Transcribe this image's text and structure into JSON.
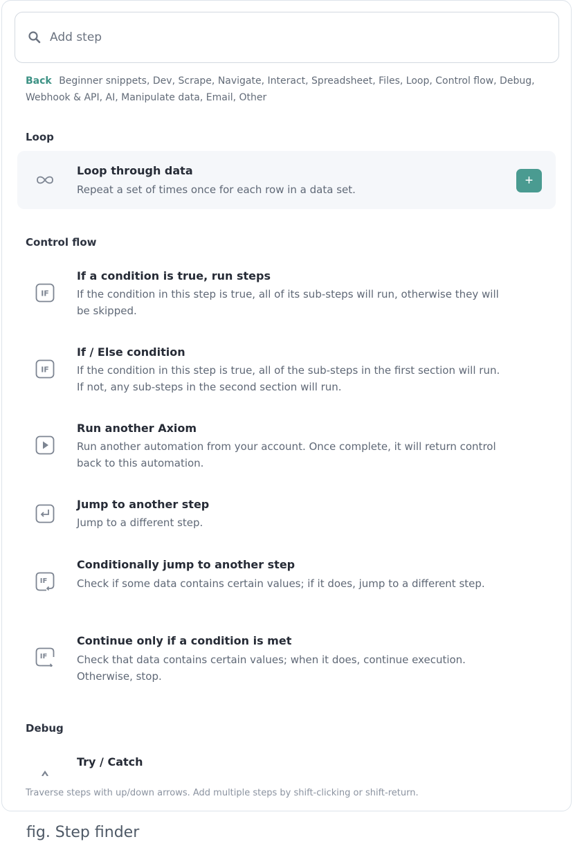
{
  "search": {
    "placeholder": "Add step",
    "value": ""
  },
  "nav": {
    "back_label": "Back",
    "categories": [
      "Beginner snippets,",
      "Dev,",
      "Scrape,",
      "Navigate,",
      "Interact,",
      "Spreadsheet,",
      "Files,",
      "Loop,",
      "Control flow,",
      "Debug,",
      "Webhook & API,",
      "AI,",
      "Manipulate data,",
      "Email,",
      "Other"
    ]
  },
  "sections": {
    "loop": {
      "title": "Loop",
      "items": [
        {
          "title": "Loop through data",
          "description": "Repeat a set of times once for each row in a data set.",
          "icon": "infinity-icon",
          "add_label": "+"
        }
      ]
    },
    "control_flow": {
      "title": "Control flow",
      "items": [
        {
          "title": "If a condition is true, run steps",
          "description": "If the condition in this step is true, all of its sub-steps will run, otherwise they will be skipped.",
          "icon": "if-icon"
        },
        {
          "title": "If / Else condition",
          "description": "If the condition in this step is true, all of the sub-steps in the first section will run. If not, any sub-steps in the second section will run.",
          "icon": "if-icon"
        },
        {
          "title": "Run another Axiom",
          "description": "Run another automation from your account. Once complete, it will return control back to this automation.",
          "icon": "play-icon"
        },
        {
          "title": "Jump to another step",
          "description": "Jump to a different step.",
          "icon": "return-arrow-icon"
        },
        {
          "title": "Conditionally jump to another step",
          "description": "Check if some data contains certain values; if it does, jump to a different step.",
          "icon": "if-jump-icon"
        },
        {
          "title": "Continue only if a condition is met",
          "description": "Check that data contains certain values; when it does, continue execution. Otherwise, stop.",
          "icon": "if-continue-icon"
        }
      ]
    },
    "debug": {
      "title": "Debug",
      "items": [
        {
          "title": "Try / Catch",
          "icon": "chevron-up-icon"
        }
      ]
    }
  },
  "footer_hint": "Traverse steps with up/down arrows. Add multiple steps by shift-clicking or shift-return.",
  "caption": "fig. Step finder",
  "colors": {
    "accent": "#4a9b91",
    "back_link": "#3d9285",
    "highlight_bg": "#f5f7fa"
  }
}
